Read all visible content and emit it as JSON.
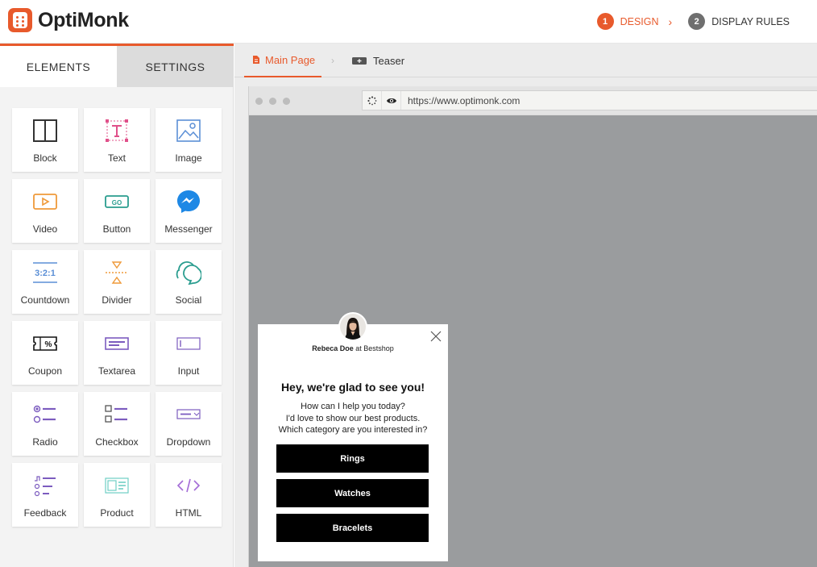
{
  "header": {
    "logo_text": "OptiMonk",
    "steps": [
      {
        "num": "1",
        "label": "DESIGN"
      },
      {
        "num": "2",
        "label": "DISPLAY RULES"
      }
    ]
  },
  "panel": {
    "tabs": [
      "ELEMENTS",
      "SETTINGS"
    ],
    "elements": [
      "Block",
      "Text",
      "Image",
      "Video",
      "Button",
      "Messenger",
      "Countdown",
      "Divider",
      "Social",
      "Coupon",
      "Textarea",
      "Input",
      "Radio",
      "Checkbox",
      "Dropdown",
      "Feedback",
      "Product",
      "HTML"
    ]
  },
  "page_tabs": {
    "main": "Main Page",
    "teaser": "Teaser"
  },
  "browser": {
    "url": "https://www.optimonk.com"
  },
  "popup": {
    "sender_name": "Rebeca Doe",
    "sender_at": "at",
    "sender_shop": "Bestshop",
    "headline": "Hey, we're glad to see you!",
    "body_lines": [
      "How can I help you today?",
      "I'd love to show our best products.",
      "Which category are you interested in?"
    ],
    "buttons": [
      "Rings",
      "Watches",
      "Bracelets"
    ]
  },
  "colors": {
    "accent": "#e85a2c",
    "step_inactive": "#6f6f6f",
    "page_background": "#9a9c9e",
    "popup_button": "#000000"
  }
}
